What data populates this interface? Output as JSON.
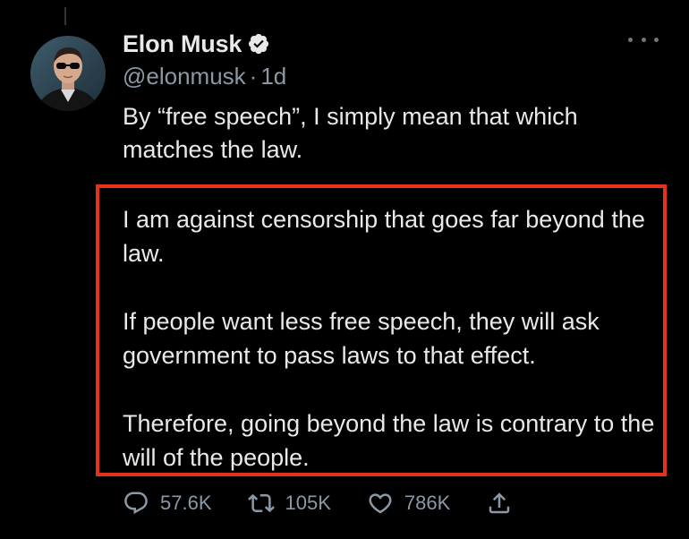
{
  "tweet": {
    "author": {
      "name": "Elon Musk",
      "handle": "@elonmusk",
      "time": "1d"
    },
    "intro_text": "By “free speech”, I simply mean that which matches the law.",
    "paragraphs": [
      "I am against censorship that goes far beyond the law.",
      "If people want less free speech, they will ask government to pass laws to that effect.",
      "Therefore, going beyond the law is contrary to the will of the people."
    ],
    "actions": {
      "replies": "57.6K",
      "retweets": "105K",
      "likes": "786K"
    }
  },
  "icons": {
    "verified": "verified-badge-icon",
    "more": "more-horizontal-icon",
    "reply": "reply-icon",
    "retweet": "retweet-icon",
    "like": "heart-icon",
    "share": "share-icon"
  },
  "colors": {
    "background": "#000000",
    "text": "#e7e9ea",
    "secondary_text": "#8b98a5",
    "highlight_border": "#e5311a"
  }
}
